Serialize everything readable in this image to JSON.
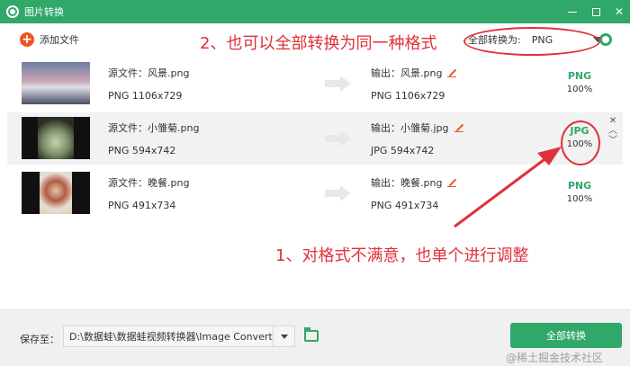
{
  "window": {
    "title": "图片转换"
  },
  "toolbar": {
    "add_file_label": "添加文件",
    "convert_all_as_label": "全部转换为:",
    "convert_all_as_value": "PNG"
  },
  "annotations": {
    "top": "2、也可以全部转换为同一种格式",
    "bottom": "1、对格式不满意，也单个进行调整",
    "color": "#e0303a"
  },
  "files": [
    {
      "source_name": "源文件：风景.png",
      "source_meta": "PNG   1106x729",
      "output_name": "输出：风景.png",
      "output_meta": "PNG   1106x729",
      "format": "PNG",
      "progress": "100%"
    },
    {
      "source_name": "源文件：小雏菊.png",
      "source_meta": "PNG   594x742",
      "output_name": "输出：小雏菊.jpg",
      "output_meta": "JPG   594x742",
      "format": "JPG",
      "progress": "100%"
    },
    {
      "source_name": "源文件：晚餐.png",
      "source_meta": "PNG   491x734",
      "output_name": "输出：晚餐.png",
      "output_meta": "PNG   491x734",
      "format": "PNG",
      "progress": "100%"
    }
  ],
  "footer": {
    "save_to_label": "保存至：",
    "save_path": "D:\\数据蛙\\数据蛙视频转换器\\Image Converter",
    "convert_all_button": "全部转换",
    "watermark": "@稀土掘金技术社区"
  },
  "colors": {
    "accent": "#2fa86a",
    "add_icon": "#f05323",
    "annotation": "#e0303a"
  },
  "icons": [
    "app-logo-icon",
    "minimize-icon",
    "maximize-icon",
    "close-icon",
    "add-icon",
    "caret-down-icon",
    "gear-icon",
    "arrow-right-icon",
    "edit-icon",
    "move-up-icon",
    "move-down-icon",
    "folder-icon"
  ]
}
